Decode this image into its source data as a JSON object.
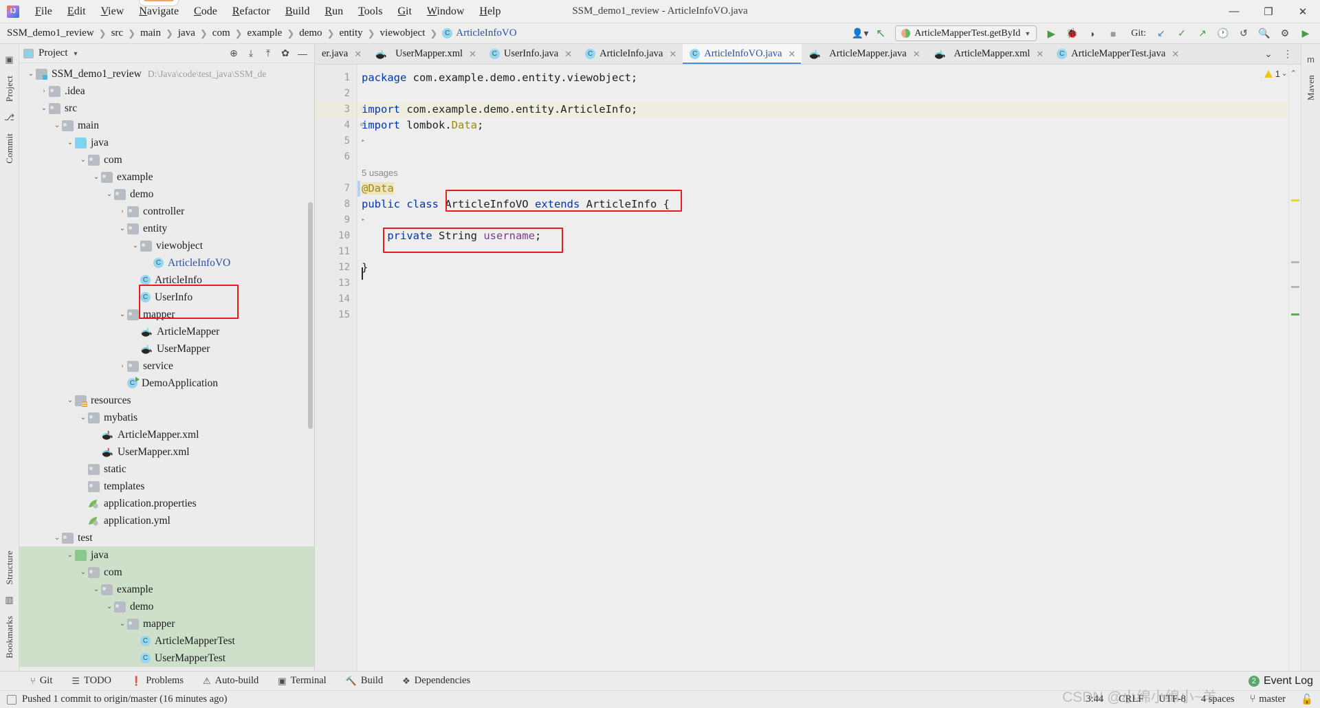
{
  "window": {
    "title": "SSM_demo1_review - ArticleInfoVO.java",
    "logo_icon": "intellij-idea-logo",
    "minimize_icon": "minimize-icon",
    "maximize_icon": "maximize-icon",
    "close_icon": "close-icon"
  },
  "menubar": {
    "items": [
      {
        "label": "File"
      },
      {
        "label": "Edit"
      },
      {
        "label": "View"
      },
      {
        "label": "Navigate"
      },
      {
        "label": "Code"
      },
      {
        "label": "Refactor"
      },
      {
        "label": "Build"
      },
      {
        "label": "Run"
      },
      {
        "label": "Tools"
      },
      {
        "label": "Git"
      },
      {
        "label": "Window"
      },
      {
        "label": "Help"
      }
    ]
  },
  "navbar": {
    "breadcrumbs": [
      {
        "label": "SSM_demo1_review"
      },
      {
        "label": "src"
      },
      {
        "label": "main"
      },
      {
        "label": "java"
      },
      {
        "label": "com"
      },
      {
        "label": "example"
      },
      {
        "label": "demo"
      },
      {
        "label": "entity"
      },
      {
        "label": "viewobject"
      },
      {
        "label": "ArticleInfoVO"
      }
    ],
    "separator": "›",
    "run_config": "ArticleMapperTest.getById",
    "git_label": "Git:",
    "icons": {
      "user_avatar": "user-avatar-icon",
      "updates": "update-project-icon",
      "run": "run-icon",
      "debug": "debug-icon",
      "run_coverage": "run-with-coverage-icon",
      "stop": "stop-icon",
      "git_update": "git-update-icon",
      "git_commit": "git-commit-icon",
      "git_push": "git-push-icon",
      "history": "history-icon",
      "rollback": "rollback-icon",
      "search": "search-icon",
      "settings": "settings-icon",
      "plugin": "plugin-icon"
    }
  },
  "left_strip": {
    "items": [
      {
        "label": "Project",
        "icon": "project-icon"
      },
      {
        "label": "Commit",
        "icon": "commit-icon"
      },
      {
        "label": "Structure",
        "icon": "structure-icon"
      },
      {
        "label": "Bookmarks",
        "icon": "bookmarks-icon"
      }
    ]
  },
  "right_strip": {
    "items": [
      {
        "label": "Maven",
        "icon": "maven-icon"
      }
    ]
  },
  "project_panel": {
    "title": "Project",
    "dropdown_icon": "chevron-down-icon",
    "actions": [
      {
        "name": "select-opened-file-icon",
        "glyph": "⊕"
      },
      {
        "name": "expand-all-icon",
        "glyph": "⤓"
      },
      {
        "name": "collapse-all-icon",
        "glyph": "⤒"
      },
      {
        "name": "settings-gear-icon",
        "glyph": "✿"
      },
      {
        "name": "hide-icon",
        "glyph": "—"
      }
    ],
    "tree": [
      {
        "depth": 0,
        "arrow": "v",
        "icon": "folder-src",
        "label": "SSM_demo1_review",
        "path": "D:\\Java\\code\\test_java\\SSM_de",
        "highlight": false
      },
      {
        "depth": 1,
        "arrow": ">",
        "icon": "folder",
        "label": ".idea",
        "path": "",
        "highlight": false
      },
      {
        "depth": 1,
        "arrow": "v",
        "icon": "folder",
        "label": "src",
        "path": "",
        "highlight": false
      },
      {
        "depth": 2,
        "arrow": "v",
        "icon": "folder",
        "label": "main",
        "path": "",
        "highlight": false
      },
      {
        "depth": 3,
        "arrow": "v",
        "icon": "folder-blue",
        "label": "java",
        "path": "",
        "highlight": false
      },
      {
        "depth": 4,
        "arrow": "v",
        "icon": "folder",
        "label": "com",
        "path": "",
        "highlight": false
      },
      {
        "depth": 5,
        "arrow": "v",
        "icon": "folder",
        "label": "example",
        "path": "",
        "highlight": false
      },
      {
        "depth": 6,
        "arrow": "v",
        "icon": "folder",
        "label": "demo",
        "path": "",
        "highlight": false
      },
      {
        "depth": 7,
        "arrow": ">",
        "icon": "folder",
        "label": "controller",
        "path": "",
        "highlight": false
      },
      {
        "depth": 7,
        "arrow": "v",
        "icon": "folder",
        "label": "entity",
        "path": "",
        "highlight": false
      },
      {
        "depth": 8,
        "arrow": "v",
        "icon": "folder",
        "label": "viewobject",
        "path": "",
        "highlight": true
      },
      {
        "depth": 9,
        "arrow": "",
        "icon": "class",
        "label": "ArticleInfoVO",
        "path": "",
        "highlight": true,
        "blue": true
      },
      {
        "depth": 8,
        "arrow": "",
        "icon": "class",
        "label": "ArticleInfo",
        "path": "",
        "highlight": false
      },
      {
        "depth": 8,
        "arrow": "",
        "icon": "class",
        "label": "UserInfo",
        "path": "",
        "highlight": false
      },
      {
        "depth": 7,
        "arrow": "v",
        "icon": "folder",
        "label": "mapper",
        "path": "",
        "highlight": false
      },
      {
        "depth": 8,
        "arrow": "",
        "icon": "mybatis",
        "label": "ArticleMapper",
        "path": "",
        "highlight": false
      },
      {
        "depth": 8,
        "arrow": "",
        "icon": "mybatis",
        "label": "UserMapper",
        "path": "",
        "highlight": false
      },
      {
        "depth": 7,
        "arrow": ">",
        "icon": "folder",
        "label": "service",
        "path": "",
        "highlight": false
      },
      {
        "depth": 7,
        "arrow": "",
        "icon": "class-runnable",
        "label": "DemoApplication",
        "path": "",
        "highlight": false
      },
      {
        "depth": 3,
        "arrow": "v",
        "icon": "folder-res",
        "label": "resources",
        "path": "",
        "highlight": false
      },
      {
        "depth": 4,
        "arrow": "v",
        "icon": "folder",
        "label": "mybatis",
        "path": "",
        "highlight": false
      },
      {
        "depth": 5,
        "arrow": "",
        "icon": "mybatis-xml",
        "label": "ArticleMapper.xml",
        "path": "",
        "highlight": false
      },
      {
        "depth": 5,
        "arrow": "",
        "icon": "mybatis-xml",
        "label": "UserMapper.xml",
        "path": "",
        "highlight": false
      },
      {
        "depth": 4,
        "arrow": "",
        "icon": "folder",
        "label": "static",
        "path": "",
        "highlight": false
      },
      {
        "depth": 4,
        "arrow": "",
        "icon": "folder",
        "label": "templates",
        "path": "",
        "highlight": false
      },
      {
        "depth": 4,
        "arrow": "",
        "icon": "spring",
        "label": "application.properties",
        "path": "",
        "highlight": false
      },
      {
        "depth": 4,
        "arrow": "",
        "icon": "spring",
        "label": "application.yml",
        "path": "",
        "highlight": false
      },
      {
        "depth": 2,
        "arrow": "v",
        "icon": "folder",
        "label": "test",
        "path": "",
        "highlight": false
      },
      {
        "depth": 3,
        "arrow": "v",
        "icon": "folder-green",
        "label": "java",
        "path": "",
        "highlight": false,
        "selected": true
      },
      {
        "depth": 4,
        "arrow": "v",
        "icon": "folder",
        "label": "com",
        "path": "",
        "highlight": false,
        "selected": true
      },
      {
        "depth": 5,
        "arrow": "v",
        "icon": "folder",
        "label": "example",
        "path": "",
        "highlight": false,
        "selected": true
      },
      {
        "depth": 6,
        "arrow": "v",
        "icon": "folder",
        "label": "demo",
        "path": "",
        "highlight": false,
        "selected": true
      },
      {
        "depth": 7,
        "arrow": "v",
        "icon": "folder",
        "label": "mapper",
        "path": "",
        "highlight": false,
        "selected": true
      },
      {
        "depth": 8,
        "arrow": "",
        "icon": "class",
        "label": "ArticleMapperTest",
        "path": "",
        "highlight": false,
        "selected": true
      },
      {
        "depth": 8,
        "arrow": "",
        "icon": "class",
        "label": "UserMapperTest",
        "path": "",
        "highlight": false,
        "selected": true
      }
    ]
  },
  "editor": {
    "tabs": [
      {
        "label": "er.java",
        "icon": "class-icon",
        "active": false,
        "partial": true
      },
      {
        "label": "UserMapper.xml",
        "icon": "mybatis-icon",
        "active": false
      },
      {
        "label": "UserInfo.java",
        "icon": "class-icon",
        "active": false
      },
      {
        "label": "ArticleInfo.java",
        "icon": "class-icon",
        "active": false
      },
      {
        "label": "ArticleInfoVO.java",
        "icon": "class-icon",
        "active": true
      },
      {
        "label": "ArticleMapper.java",
        "icon": "mybatis-icon",
        "active": false
      },
      {
        "label": "ArticleMapper.xml",
        "icon": "mybatis-icon",
        "active": false
      },
      {
        "label": "ArticleMapperTest.java",
        "icon": "class-icon",
        "active": false
      }
    ],
    "tab_close_glyph": "✕",
    "tabbar_actions": [
      {
        "name": "tab-list-icon",
        "glyph": "⌄"
      },
      {
        "name": "more-options-icon",
        "glyph": "⋮"
      }
    ],
    "warning_count": "1",
    "gutter_lines": [
      "1",
      "2",
      "3",
      "4",
      "5",
      "6",
      "7",
      "8",
      "9",
      "10",
      "11",
      "12",
      "13",
      "14",
      "15"
    ],
    "lines": [
      {
        "n": 1,
        "tokens": [
          {
            "t": "package ",
            "c": "kw"
          },
          {
            "t": "com.example.demo.entity.viewobject;",
            "c": "plain"
          }
        ]
      },
      {
        "n": 2,
        "tokens": []
      },
      {
        "n": 3,
        "highlight": true,
        "fold": true,
        "tokens": [
          {
            "t": "import ",
            "c": "kw"
          },
          {
            "t": "com.example.demo.entity.ArticleInfo;",
            "c": "plain"
          }
        ]
      },
      {
        "n": 4,
        "fold": true,
        "tokens": [
          {
            "t": "import ",
            "c": "kw"
          },
          {
            "t": "lombok.",
            "c": "plain"
          },
          {
            "t": "Data",
            "c": "ann-plain"
          },
          {
            "t": ";",
            "c": "plain"
          }
        ]
      },
      {
        "n": 5,
        "tokens": []
      },
      {
        "n": 6,
        "tokens": []
      },
      {
        "n": 7,
        "usages": "5 usages",
        "tokens": [
          {
            "t": "@Data",
            "c": "ann"
          }
        ]
      },
      {
        "n": 8,
        "tokens": [
          {
            "t": "public class ",
            "c": "kw"
          },
          {
            "t": "ArticleInfoVO ",
            "c": "plain"
          },
          {
            "t": "extends ",
            "c": "kw"
          },
          {
            "t": "ArticleInfo ",
            "c": "plain"
          },
          {
            "t": "{",
            "c": "plain"
          }
        ]
      },
      {
        "n": 9,
        "tokens": []
      },
      {
        "n": 10,
        "tokens": [
          {
            "t": "    private ",
            "c": "kw"
          },
          {
            "t": "String ",
            "c": "plain"
          },
          {
            "t": "username",
            "c": "fld"
          },
          {
            "t": ";",
            "c": "plain"
          }
        ]
      },
      {
        "n": 11,
        "tokens": []
      },
      {
        "n": 12,
        "tokens": [
          {
            "t": "}",
            "c": "plain"
          }
        ]
      },
      {
        "n": 13,
        "tokens": []
      },
      {
        "n": 14,
        "tokens": []
      },
      {
        "n": 15,
        "tokens": []
      }
    ],
    "annotations": [
      {
        "name": "class-declaration-highlight-box"
      },
      {
        "name": "field-declaration-highlight-box"
      }
    ]
  },
  "toolwindow_bar": {
    "items": [
      {
        "label": "Git",
        "icon": "git-branch-icon"
      },
      {
        "label": "TODO",
        "icon": "todo-list-icon"
      },
      {
        "label": "Problems",
        "icon": "problems-icon"
      },
      {
        "label": "Auto-build",
        "icon": "auto-build-icon"
      },
      {
        "label": "Terminal",
        "icon": "terminal-icon"
      },
      {
        "label": "Build",
        "icon": "build-hammer-icon"
      },
      {
        "label": "Dependencies",
        "icon": "dependencies-icon"
      }
    ],
    "event_log": {
      "label": "Event Log",
      "count": "2"
    }
  },
  "statusbar": {
    "message": "Pushed 1 commit to origin/master (16 minutes ago)",
    "message_icon": "notification-icon",
    "caret_position": "3:44",
    "line_separator": "CRLF",
    "encoding": "UTF-8",
    "indent": "4 spaces",
    "branch": "master",
    "branch_icon": "git-branch-icon",
    "lock_icon": "read-only-toggle-icon"
  },
  "watermark": "CSDN @小绵小绵小~羊"
}
